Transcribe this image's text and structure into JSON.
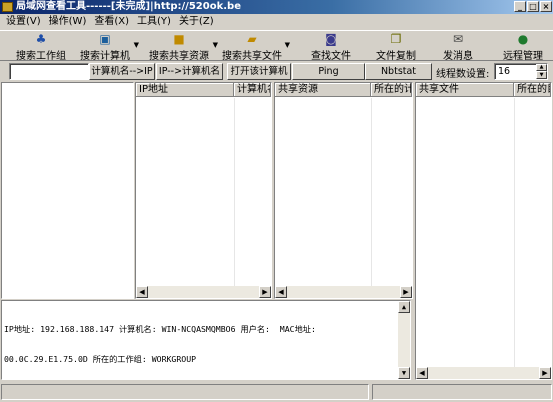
{
  "window": {
    "title": "局域网查看工具------[未完成]|http://520ok.be",
    "controls": {
      "minimize": "_",
      "maximize": "□",
      "close": "×"
    }
  },
  "menu": [
    "设置(V)",
    "操作(W)",
    "查看(X)",
    "工具(Y)",
    "关于(Z)"
  ],
  "toolbar": {
    "search_workgroup": "搜索工作组",
    "search_computer": "搜索计算机",
    "search_share": "搜索共享资源",
    "search_share_file": "搜索共享文件",
    "find_file": "查找文件",
    "copy_file": "文件复制",
    "send_message": "发消息",
    "remote_manage": "远程管理"
  },
  "cmdbar": {
    "address_value": "",
    "name_to_ip": "计算机名-->IP",
    "ip_to_name": "IP-->计算机名",
    "open_computer": "打开该计算机",
    "ping": "Ping",
    "nbtstat": "Nbtstat",
    "thread_label": "线程数设置:",
    "thread_value": "16"
  },
  "panels": {
    "computers": {
      "col_ip": "IP地址",
      "col_name": "计算机名"
    },
    "shares": {
      "col_share": "共享资源",
      "col_location": "所在的计算机"
    },
    "files": {
      "col_file": "共享文件",
      "col_location": "所在的目录"
    }
  },
  "log": {
    "line1": "IP地址: 192.168.188.147 计算机名: WIN-NCQASMQMBO6 用户名:  MAC地址:",
    "line2": "00.0C.29.E1.75.0D 所在的工作组: WORKGROUP"
  },
  "colors": {
    "titlebar": "#0a246a",
    "face": "#d4d0c8"
  }
}
